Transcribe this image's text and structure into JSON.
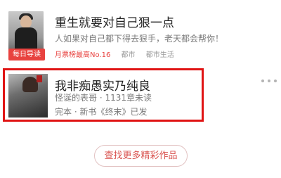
{
  "books": [
    {
      "title": "重生就要对自己狠一点",
      "description": "人如果对自己都下得去狠手，老天都会帮你！",
      "badge": "每日导读",
      "rank": "月票榜最高No.16",
      "tags": [
        "都市",
        "都市生活"
      ]
    },
    {
      "title": "我非痴愚实乃纯良",
      "author_line": "怪诞的表哥 · 1131章未读",
      "status_line": "完本 · 新书《终末》已发",
      "cover_text": "我非痴愚实乃纯良"
    }
  ],
  "find_more_label": "查找更多精彩作品",
  "colors": {
    "accent": "#e8423f",
    "highlight_border": "#e01414",
    "title": "#222222",
    "secondary": "#7a7a7a"
  },
  "icons": {
    "more": "more-icon"
  }
}
